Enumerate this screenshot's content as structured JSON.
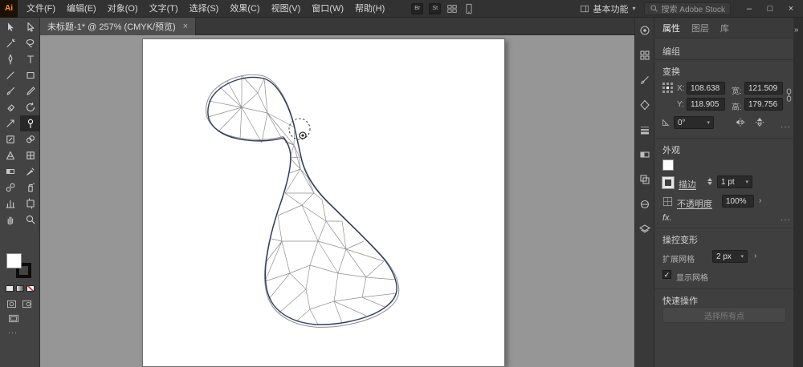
{
  "window": {
    "minimize": "–",
    "maximize": "□",
    "close": "×"
  },
  "menubar": {
    "logo": "Ai",
    "items": [
      "文件(F)",
      "编辑(E)",
      "对象(O)",
      "文字(T)",
      "选择(S)",
      "效果(C)",
      "视图(V)",
      "窗口(W)",
      "帮助(H)"
    ],
    "badges": [
      "Br",
      "St"
    ],
    "workspace": "基本功能",
    "search": "搜索 Adobe Stock"
  },
  "tabbar": {
    "doc_tab": "未标题-1* @ 257% (CMYK/预览)",
    "close": "×"
  },
  "properties": {
    "tabs": [
      "属性",
      "图层",
      "库"
    ],
    "object_type": "编组",
    "transform": {
      "title": "变换",
      "x_label": "X:",
      "x_value": "108.638",
      "y_label": "Y:",
      "y_value": "118.905",
      "w_label": "宽:",
      "w_value": "121.509",
      "h_label": "高:",
      "h_value": "179.756",
      "angle_value": "0°"
    },
    "appearance": {
      "title": "外观",
      "stroke_label": "描边",
      "stroke_value": "1 pt",
      "opacity_label": "不透明度",
      "opacity_value": "100%",
      "fx_label": "fx."
    },
    "puppet_warp": {
      "title": "操控变形",
      "expand_label": "扩展网格",
      "expand_value": "2 px",
      "show_mesh_label": "显示网格",
      "show_mesh_checked": "✓"
    },
    "quick_actions": {
      "title": "快速操作",
      "button_label": "选择所有点"
    }
  },
  "icons": {
    "caret_down": "▾",
    "chevron_right": "›",
    "collapse": "»",
    "more": "···",
    "dots": "···"
  },
  "colors": {
    "menubar_bg": "#323232",
    "panel_bg": "#3f3f3f",
    "toolbar_bg": "#434343",
    "canvas_bg": "#969696",
    "artboard": "#ffffff",
    "field_bg": "#2a2a2a",
    "outline_blue": "#2e3a66",
    "mesh_gray": "#8d8d8d",
    "logo_orange": "#ff9a00"
  }
}
